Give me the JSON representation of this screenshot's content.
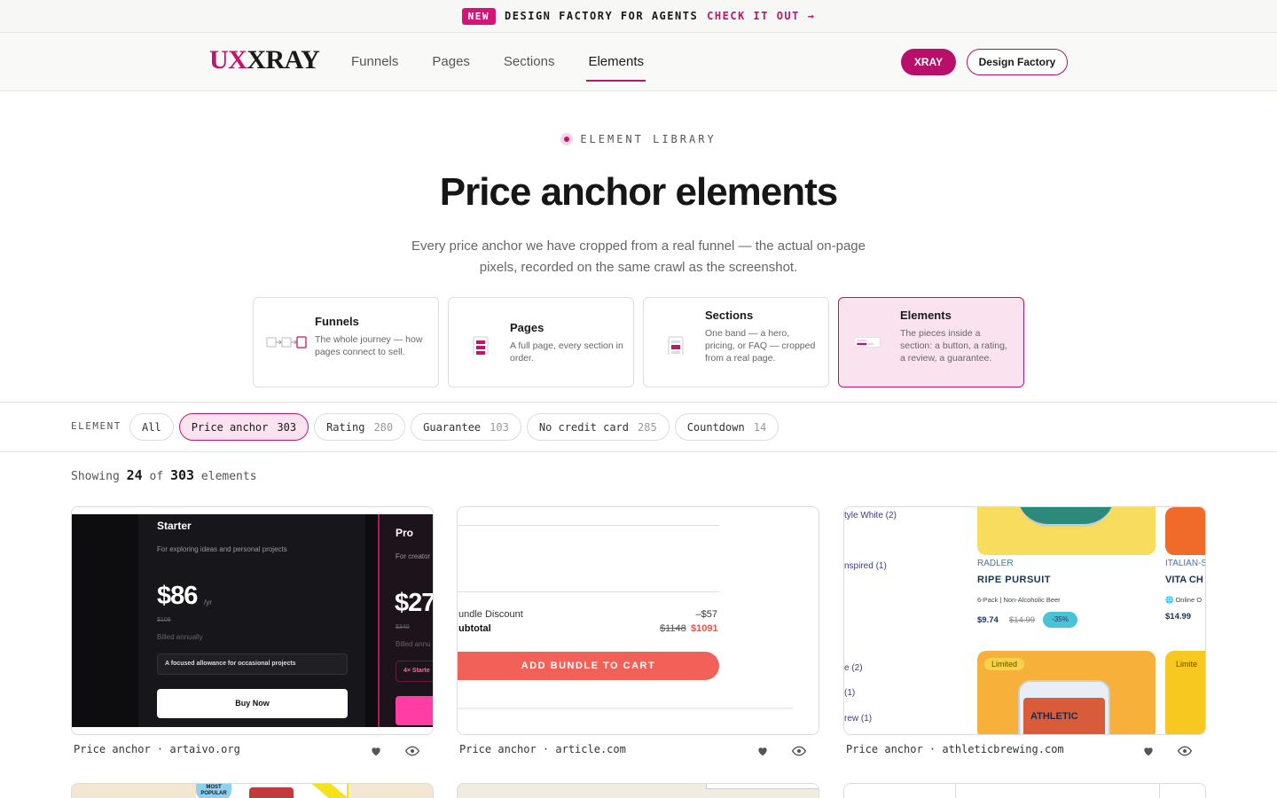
{
  "announcement": {
    "badge": "NEW",
    "text": "DESIGN FACTORY FOR AGENTS",
    "cta": "CHECK IT OUT →"
  },
  "nav": {
    "logo_ux": "UX",
    "logo_xray": "XRAY",
    "links": [
      "Funnels",
      "Pages",
      "Sections",
      "Elements"
    ],
    "active_link": "Elements",
    "xray_button": "XRAY",
    "design_factory_button": "Design Factory"
  },
  "hero": {
    "eyebrow": "ELEMENT LIBRARY",
    "title": "Price anchor elements",
    "subtitle": "Every price anchor we have cropped from a real funnel — the actual on-page pixels, recorded on the same crawl as the screenshot."
  },
  "library": [
    {
      "title": "Funnels",
      "desc": "The whole journey — how pages connect to sell.",
      "icon": "funnel-flow-icon"
    },
    {
      "title": "Pages",
      "desc": "A full page, every section in order.",
      "icon": "page-stack-icon"
    },
    {
      "title": "Sections",
      "desc": "One band — a hero, pricing, or FAQ — cropped from a real page.",
      "icon": "section-band-icon"
    },
    {
      "title": "Elements",
      "desc": "The pieces inside a section: a button, a rating, a review, a guarantee.",
      "icon": "element-pieces-icon",
      "active": true
    }
  ],
  "filter": {
    "label": "ELEMENT",
    "chips": [
      {
        "label": "All",
        "count": ""
      },
      {
        "label": "Price anchor",
        "count": "303",
        "active": true
      },
      {
        "label": "Rating",
        "count": "280"
      },
      {
        "label": "Guarantee",
        "count": "103"
      },
      {
        "label": "No credit card",
        "count": "285"
      },
      {
        "label": "Countdown",
        "count": "14"
      }
    ]
  },
  "showing": {
    "prefix": "Showing",
    "shown": "24",
    "of": "of",
    "total": "303",
    "suffix": "elements"
  },
  "cards": [
    {
      "caption": "Price anchor · artaivo.org",
      "preview": {
        "plan1_name": "Starter",
        "plan1_desc": "For exploring ideas and personal projects",
        "plan1_price": "$86",
        "plan1_period": "/yr",
        "plan1_old": "$108",
        "plan1_billing": "Billed annually",
        "plan1_feature": "A focused allowance for occasional projects",
        "plan1_button": "Buy Now",
        "plan2_name": "Pro",
        "plan2_desc": "For creator",
        "plan2_price": "$27",
        "plan2_old": "$340",
        "plan2_billing": "Billed annu",
        "plan2_feature": "4× Starte"
      }
    },
    {
      "caption": "Price anchor · article.com",
      "preview": {
        "discount_label": "undle Discount",
        "discount_value": "–$57",
        "subtotal_label": "ubtotal",
        "subtotal_old": "$1148",
        "subtotal_new": "$1091",
        "button": "ADD BUNDLE TO CART"
      }
    },
    {
      "caption": "Price anchor · athleticbrewing.com",
      "preview": {
        "filter_1": "tyle White (2)",
        "filter_2": "nspired (1)",
        "filter_3": "e (2)",
        "filter_4": "(1)",
        "filter_5": "rew (1)",
        "product_kicker": "RADLER",
        "product_name": "RIPE PURSUIT",
        "product_desc": "6-Pack | Non-Alcoholic Beer",
        "price": "$9.74",
        "old_price": "$14.99",
        "discount": "-35%",
        "product2_kicker": "ITALIAN-S",
        "product2_name": "VITA CH",
        "product2_desc": "Online O",
        "product2_price": "$14.99",
        "tag1": "Limited",
        "tag2": "Limite",
        "can_text": "ATHLETIC"
      }
    }
  ],
  "row2": {
    "badge1": "MOST POPULAR"
  }
}
